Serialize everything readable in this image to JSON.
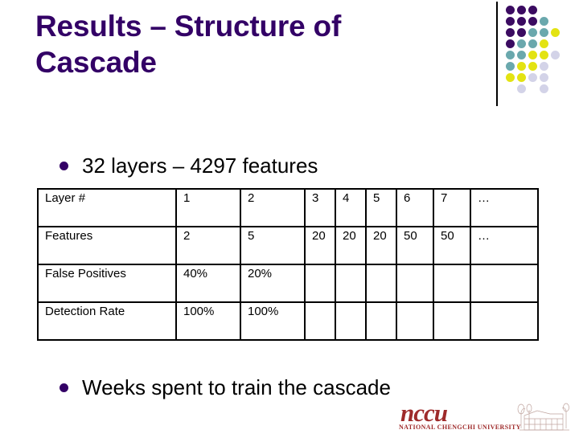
{
  "slide": {
    "title": "Results – Structure of Cascade",
    "background_color": "#ffffff",
    "title_color": "#330066"
  },
  "bullets": [
    {
      "marker": "bullet-dot",
      "text": "32 layers – 4297 features"
    },
    {
      "marker": "bullet-dot",
      "text": "Weeks spent to train the cascade"
    }
  ],
  "table": {
    "rows": [
      {
        "label": "Layer #",
        "cells": [
          "1",
          "2",
          "3",
          "4",
          "5",
          "6",
          "7",
          "…"
        ]
      },
      {
        "label": "Features",
        "cells": [
          "2",
          "5",
          "20",
          "20",
          "20",
          "50",
          "50",
          "…"
        ]
      },
      {
        "label": "False Positives",
        "cells": [
          "40%",
          "20%",
          "",
          "",
          "",
          "",
          "",
          ""
        ]
      },
      {
        "label": "Detection Rate",
        "cells": [
          "100%",
          "100%",
          "",
          "",
          "",
          "",
          "",
          ""
        ]
      }
    ]
  },
  "decoration": {
    "name": "dot-grid-decoration",
    "colors": {
      "purple": "#3b0b61",
      "teal": "#6aa8ad",
      "yellow": "#e3e312",
      "lavender": "#d3d3e8"
    },
    "grid": [
      [
        "purple",
        "purple",
        "purple",
        "",
        ""
      ],
      [
        "purple",
        "purple",
        "purple",
        "teal",
        ""
      ],
      [
        "purple",
        "purple",
        "teal",
        "teal",
        "yellow"
      ],
      [
        "purple",
        "teal",
        "teal",
        "yellow",
        ""
      ],
      [
        "teal",
        "teal",
        "yellow",
        "yellow",
        "lavender"
      ],
      [
        "teal",
        "yellow",
        "yellow",
        "lavender",
        ""
      ],
      [
        "yellow",
        "yellow",
        "lavender",
        "lavender",
        ""
      ],
      [
        "",
        "lavender",
        "",
        "lavender",
        ""
      ]
    ]
  },
  "logo": {
    "name": "nccu-logo",
    "wordmark": "nccu",
    "subtitle": "NATIONAL CHENGCHI UNIVERSITY",
    "color": "#9e2a2a"
  }
}
